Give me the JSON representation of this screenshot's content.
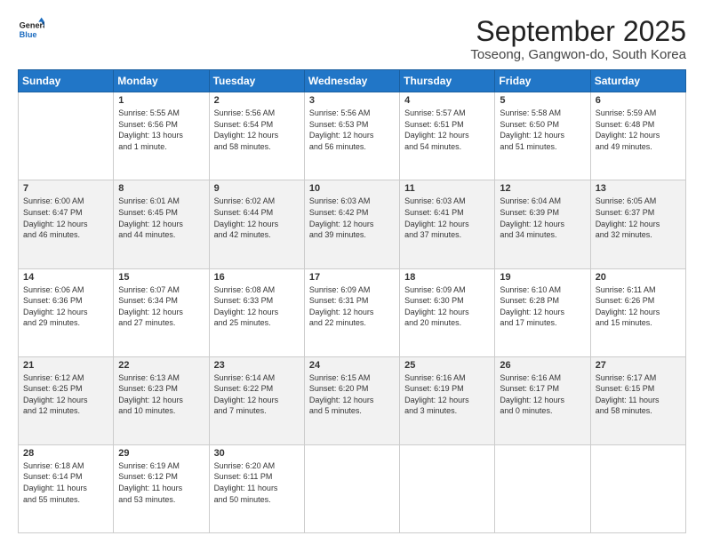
{
  "header": {
    "logo_line1": "General",
    "logo_line2": "Blue",
    "month": "September 2025",
    "location": "Toseong, Gangwon-do, South Korea"
  },
  "weekdays": [
    "Sunday",
    "Monday",
    "Tuesday",
    "Wednesday",
    "Thursday",
    "Friday",
    "Saturday"
  ],
  "weeks": [
    [
      {
        "day": "",
        "info": ""
      },
      {
        "day": "1",
        "info": "Sunrise: 5:55 AM\nSunset: 6:56 PM\nDaylight: 13 hours\nand 1 minute."
      },
      {
        "day": "2",
        "info": "Sunrise: 5:56 AM\nSunset: 6:54 PM\nDaylight: 12 hours\nand 58 minutes."
      },
      {
        "day": "3",
        "info": "Sunrise: 5:56 AM\nSunset: 6:53 PM\nDaylight: 12 hours\nand 56 minutes."
      },
      {
        "day": "4",
        "info": "Sunrise: 5:57 AM\nSunset: 6:51 PM\nDaylight: 12 hours\nand 54 minutes."
      },
      {
        "day": "5",
        "info": "Sunrise: 5:58 AM\nSunset: 6:50 PM\nDaylight: 12 hours\nand 51 minutes."
      },
      {
        "day": "6",
        "info": "Sunrise: 5:59 AM\nSunset: 6:48 PM\nDaylight: 12 hours\nand 49 minutes."
      }
    ],
    [
      {
        "day": "7",
        "info": "Sunrise: 6:00 AM\nSunset: 6:47 PM\nDaylight: 12 hours\nand 46 minutes."
      },
      {
        "day": "8",
        "info": "Sunrise: 6:01 AM\nSunset: 6:45 PM\nDaylight: 12 hours\nand 44 minutes."
      },
      {
        "day": "9",
        "info": "Sunrise: 6:02 AM\nSunset: 6:44 PM\nDaylight: 12 hours\nand 42 minutes."
      },
      {
        "day": "10",
        "info": "Sunrise: 6:03 AM\nSunset: 6:42 PM\nDaylight: 12 hours\nand 39 minutes."
      },
      {
        "day": "11",
        "info": "Sunrise: 6:03 AM\nSunset: 6:41 PM\nDaylight: 12 hours\nand 37 minutes."
      },
      {
        "day": "12",
        "info": "Sunrise: 6:04 AM\nSunset: 6:39 PM\nDaylight: 12 hours\nand 34 minutes."
      },
      {
        "day": "13",
        "info": "Sunrise: 6:05 AM\nSunset: 6:37 PM\nDaylight: 12 hours\nand 32 minutes."
      }
    ],
    [
      {
        "day": "14",
        "info": "Sunrise: 6:06 AM\nSunset: 6:36 PM\nDaylight: 12 hours\nand 29 minutes."
      },
      {
        "day": "15",
        "info": "Sunrise: 6:07 AM\nSunset: 6:34 PM\nDaylight: 12 hours\nand 27 minutes."
      },
      {
        "day": "16",
        "info": "Sunrise: 6:08 AM\nSunset: 6:33 PM\nDaylight: 12 hours\nand 25 minutes."
      },
      {
        "day": "17",
        "info": "Sunrise: 6:09 AM\nSunset: 6:31 PM\nDaylight: 12 hours\nand 22 minutes."
      },
      {
        "day": "18",
        "info": "Sunrise: 6:09 AM\nSunset: 6:30 PM\nDaylight: 12 hours\nand 20 minutes."
      },
      {
        "day": "19",
        "info": "Sunrise: 6:10 AM\nSunset: 6:28 PM\nDaylight: 12 hours\nand 17 minutes."
      },
      {
        "day": "20",
        "info": "Sunrise: 6:11 AM\nSunset: 6:26 PM\nDaylight: 12 hours\nand 15 minutes."
      }
    ],
    [
      {
        "day": "21",
        "info": "Sunrise: 6:12 AM\nSunset: 6:25 PM\nDaylight: 12 hours\nand 12 minutes."
      },
      {
        "day": "22",
        "info": "Sunrise: 6:13 AM\nSunset: 6:23 PM\nDaylight: 12 hours\nand 10 minutes."
      },
      {
        "day": "23",
        "info": "Sunrise: 6:14 AM\nSunset: 6:22 PM\nDaylight: 12 hours\nand 7 minutes."
      },
      {
        "day": "24",
        "info": "Sunrise: 6:15 AM\nSunset: 6:20 PM\nDaylight: 12 hours\nand 5 minutes."
      },
      {
        "day": "25",
        "info": "Sunrise: 6:16 AM\nSunset: 6:19 PM\nDaylight: 12 hours\nand 3 minutes."
      },
      {
        "day": "26",
        "info": "Sunrise: 6:16 AM\nSunset: 6:17 PM\nDaylight: 12 hours\nand 0 minutes."
      },
      {
        "day": "27",
        "info": "Sunrise: 6:17 AM\nSunset: 6:15 PM\nDaylight: 11 hours\nand 58 minutes."
      }
    ],
    [
      {
        "day": "28",
        "info": "Sunrise: 6:18 AM\nSunset: 6:14 PM\nDaylight: 11 hours\nand 55 minutes."
      },
      {
        "day": "29",
        "info": "Sunrise: 6:19 AM\nSunset: 6:12 PM\nDaylight: 11 hours\nand 53 minutes."
      },
      {
        "day": "30",
        "info": "Sunrise: 6:20 AM\nSunset: 6:11 PM\nDaylight: 11 hours\nand 50 minutes."
      },
      {
        "day": "",
        "info": ""
      },
      {
        "day": "",
        "info": ""
      },
      {
        "day": "",
        "info": ""
      },
      {
        "day": "",
        "info": ""
      }
    ]
  ]
}
